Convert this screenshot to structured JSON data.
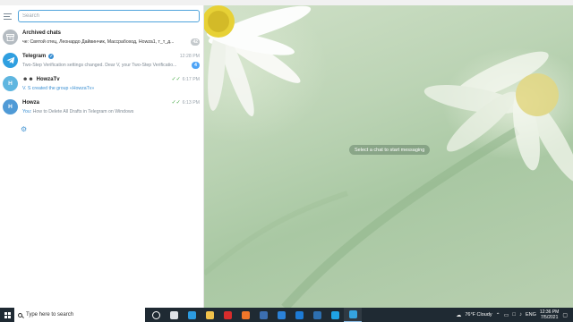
{
  "search": {
    "placeholder": "Search",
    "value": ""
  },
  "chats": [
    {
      "title": "Archived chats",
      "preview": "че: Святой отец, Леонардо Дайвинчик, Массрабоход, Howza1, т_т_д...",
      "time": "",
      "badge": "42",
      "avatar_text": "",
      "avatar_color": "#b5bcc2",
      "icon": "archive-icon"
    },
    {
      "title": "Telegram",
      "preview": "Two-Step Verification settings changed. Dear V, your Two-Step Verificatio...",
      "time": "12:28 PM",
      "badge": "4",
      "avatar_text": "",
      "avatar_color": "#2f9fe0",
      "icon": "telegram-icon"
    },
    {
      "title": "HowzaTv",
      "preview_prefix": "V. S created the group «HowzaTv»",
      "time": "6:17 PM",
      "avatar_text": "H",
      "avatar_color": "#5fb6e0"
    },
    {
      "title": "Howza",
      "preview_prefix": "You:",
      "preview": "How to Delete All Drafts in Telegram on Windows",
      "time": "6:13 PM",
      "avatar_text": "H",
      "avatar_color": "#4f9ad6"
    }
  ],
  "main": {
    "placeholder_text": "Select a chat to start messaging"
  },
  "taskbar": {
    "search_text": "Type here to search",
    "weather": "76°F  Cloudy",
    "language": "ENG",
    "time": "12:36 PM",
    "date": "7/5/2021",
    "apps": [
      {
        "name": "cortana-icon",
        "color": "#ffffff"
      },
      {
        "name": "task-view-icon",
        "color": "#dfe3e8"
      },
      {
        "name": "edge-icon",
        "color": "#2c9be0"
      },
      {
        "name": "file-explorer-icon",
        "color": "#f1c24b"
      },
      {
        "name": "opera-icon",
        "color": "#d82c2c"
      },
      {
        "name": "firefox-icon",
        "color": "#f0762a"
      },
      {
        "name": "store-icon",
        "color": "#3c6fb2"
      },
      {
        "name": "trello-icon",
        "color": "#2b82d9"
      },
      {
        "name": "mail-icon",
        "color": "#1d7bd6"
      },
      {
        "name": "photos-icon",
        "color": "#2d6fb0"
      },
      {
        "name": "skype-icon",
        "color": "#1fa3e6"
      },
      {
        "name": "telegram-taskbar-icon",
        "color": "#35a3de"
      }
    ]
  }
}
